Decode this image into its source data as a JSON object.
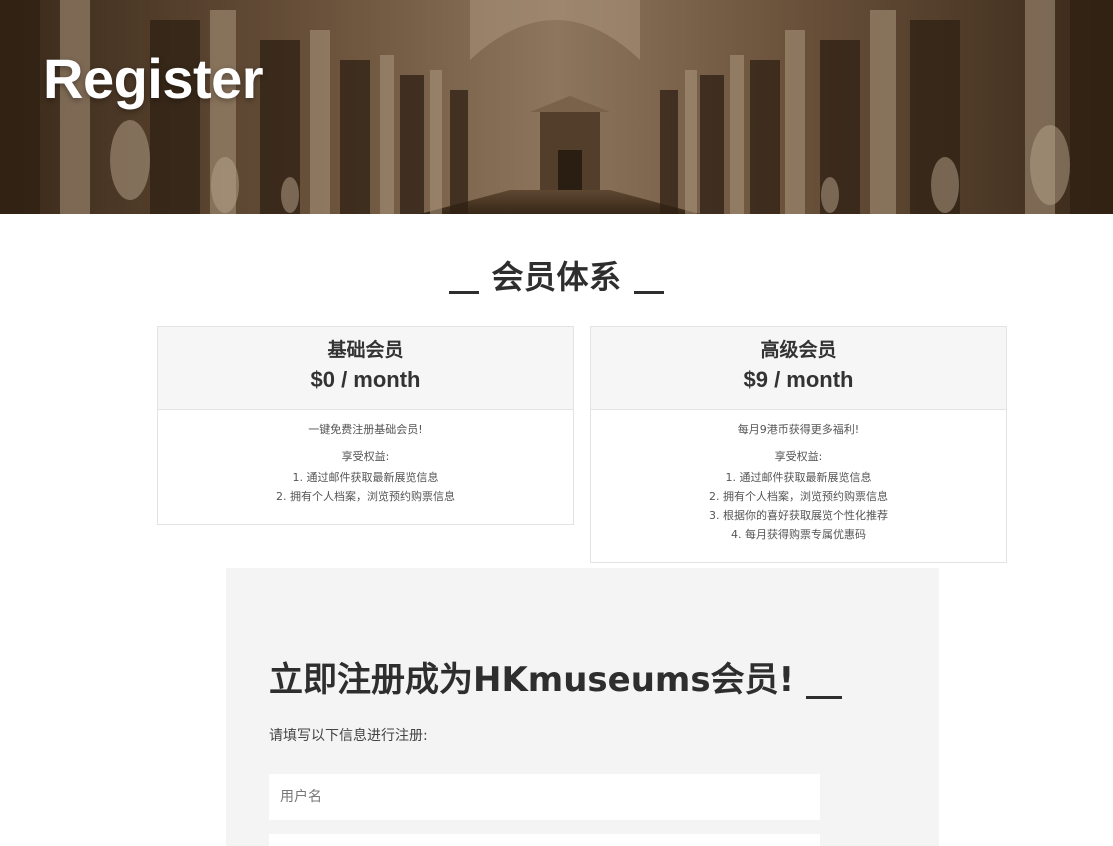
{
  "hero": {
    "title": "Register"
  },
  "membership": {
    "title": "会员体系",
    "plans": [
      {
        "name": "基础会员",
        "price": "$0 / month",
        "intro": "一键免费注册基础会员!",
        "benefits_label": "享受权益:",
        "benefits": [
          "1. 通过邮件获取最新展览信息",
          "2. 拥有个人档案，浏览预约购票信息"
        ]
      },
      {
        "name": "高级会员",
        "price": "$9 / month",
        "intro": "每月9港币获得更多福利!",
        "benefits_label": "享受权益:",
        "benefits": [
          "1. 通过邮件获取最新展览信息",
          "2. 拥有个人档案，浏览预约购票信息",
          "3. 根据你的喜好获取展览个性化推荐",
          "4. 每月获得购票专属优惠码"
        ]
      }
    ]
  },
  "register": {
    "title": "立即注册成为HKmuseums会员!",
    "hint": "请填写以下信息进行注册:",
    "username_placeholder": "用户名",
    "next_placeholder": ""
  },
  "colors": {
    "hero_overlay": "#5a4530",
    "panel_bg": "#f4f4f4",
    "card_head_bg": "#f6f6f6",
    "text_dark": "#2e2e2e"
  }
}
